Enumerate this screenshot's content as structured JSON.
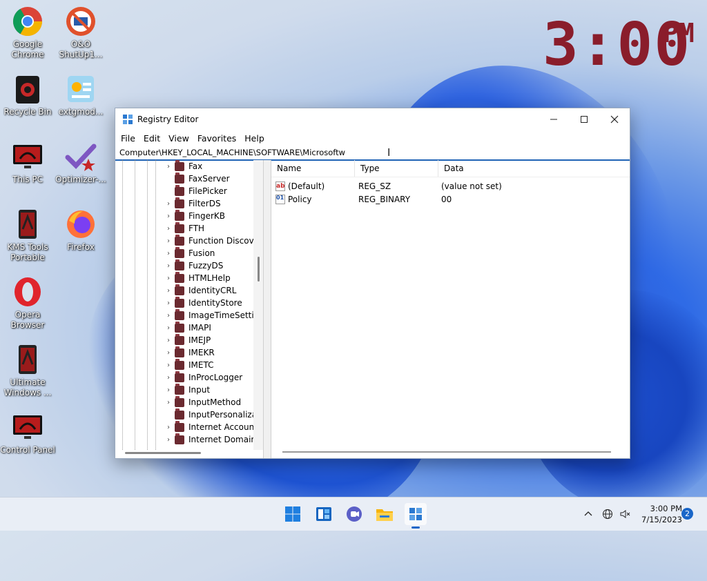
{
  "clock_widget": {
    "time": "3:00",
    "ampm": "PM"
  },
  "desktop_icons": [
    {
      "label": "Google Chrome",
      "icon": "chrome-icon"
    },
    {
      "label": "O&O ShutUp1...",
      "icon": "oo-shutup-icon"
    },
    {
      "label": "Recycle Bin",
      "icon": "recycle-bin-icon"
    },
    {
      "label": "extgmod...",
      "icon": "extgmod-icon"
    },
    {
      "label": "This PC",
      "icon": "this-pc-icon"
    },
    {
      "label": "Optimizer-...",
      "icon": "optimizer-icon"
    },
    {
      "label": "KMS Tools Portable",
      "icon": "kms-tools-icon"
    },
    {
      "label": "Firefox",
      "icon": "firefox-icon"
    },
    {
      "label": "Opera Browser",
      "icon": "opera-icon"
    },
    {
      "label": "Ultimate Windows ...",
      "icon": "ultimate-windows-icon"
    },
    {
      "label": "Control Panel",
      "icon": "control-panel-icon"
    }
  ],
  "window": {
    "title": "Registry Editor",
    "menu": [
      "File",
      "Edit",
      "View",
      "Favorites",
      "Help"
    ],
    "address": "Computer\\HKEY_LOCAL_MACHINE\\SOFTWARE\\Microsoftw",
    "tree_items": [
      {
        "label": "Fax",
        "expandable": true
      },
      {
        "label": "FaxServer",
        "expandable": false
      },
      {
        "label": "FilePicker",
        "expandable": false
      },
      {
        "label": "FilterDS",
        "expandable": true
      },
      {
        "label": "FingerKB",
        "expandable": true
      },
      {
        "label": "FTH",
        "expandable": true
      },
      {
        "label": "Function Discover",
        "expandable": true
      },
      {
        "label": "Fusion",
        "expandable": true
      },
      {
        "label": "FuzzyDS",
        "expandable": true
      },
      {
        "label": "HTMLHelp",
        "expandable": true
      },
      {
        "label": "IdentityCRL",
        "expandable": true
      },
      {
        "label": "IdentityStore",
        "expandable": true
      },
      {
        "label": "ImageTimeSetting",
        "expandable": true
      },
      {
        "label": "IMAPI",
        "expandable": true
      },
      {
        "label": "IMEJP",
        "expandable": true
      },
      {
        "label": "IMEKR",
        "expandable": true
      },
      {
        "label": "IMETC",
        "expandable": true
      },
      {
        "label": "InProcLogger",
        "expandable": true
      },
      {
        "label": "Input",
        "expandable": true
      },
      {
        "label": "InputMethod",
        "expandable": true
      },
      {
        "label": "InputPersonalizati",
        "expandable": false
      },
      {
        "label": "Internet Account",
        "expandable": true
      },
      {
        "label": "Internet Domains",
        "expandable": true
      }
    ],
    "columns": [
      "Name",
      "Type",
      "Data"
    ],
    "values": [
      {
        "name": "(Default)",
        "type": "REG_SZ",
        "data": "(value not set)",
        "icon": "ab"
      },
      {
        "name": "Policy",
        "type": "REG_BINARY",
        "data": "00",
        "icon": "011"
      }
    ]
  },
  "taskbar": {
    "apps": [
      "start-icon",
      "widgets-icon",
      "chat-icon",
      "file-explorer-icon",
      "registry-editor-icon"
    ],
    "time": "3:00 PM",
    "date": "7/15/2023",
    "notifications": "2"
  }
}
